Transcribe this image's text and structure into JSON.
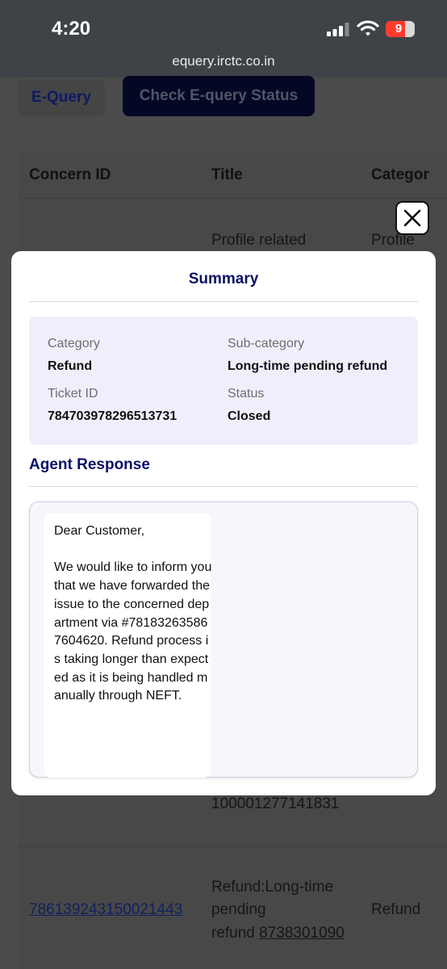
{
  "status_bar": {
    "time": "4:20",
    "url": "equery.irctc.co.in",
    "battery": "9",
    "icons": [
      "cellular-signal-icon",
      "wifi-icon",
      "battery-icon"
    ]
  },
  "background_page": {
    "tabs": [
      {
        "label": "E-Query"
      },
      {
        "label": "Check E-query Status"
      }
    ],
    "table": {
      "headers": [
        "Concern ID",
        "Title",
        "Categor"
      ],
      "rows": [
        {
          "title": "Profile related",
          "category": "Profile"
        },
        {
          "title_tail": "100001277141831"
        },
        {
          "concern_id": "786139243150021443",
          "title_line1": "Refund:Long-time",
          "title_line2": "pending",
          "title_line3_prefix": "refund",
          "title_line3_link": "8738301090",
          "category": "Refund"
        }
      ]
    }
  },
  "modal": {
    "title": "Summary",
    "summary": {
      "category_label": "Category",
      "category_value": "Refund",
      "subcategory_label": "Sub-category",
      "subcategory_value": "Long-time pending refund",
      "ticket_label": "Ticket ID",
      "ticket_value": "784703978296513731",
      "status_label": "Status",
      "status_value": "Closed"
    },
    "agent_response_title": "Agent Response",
    "agent_response_text": "Dear Customer,\n\nWe would like to inform you that we have forwarded the issue to the concerned department via #781832635867604620. Refund process is taking longer than expected as it is being handled manually through NEFT."
  },
  "colors": {
    "accent": "#0b1267",
    "summary_card_bg": "#efeffc",
    "overlay": "#4a4a4a"
  }
}
